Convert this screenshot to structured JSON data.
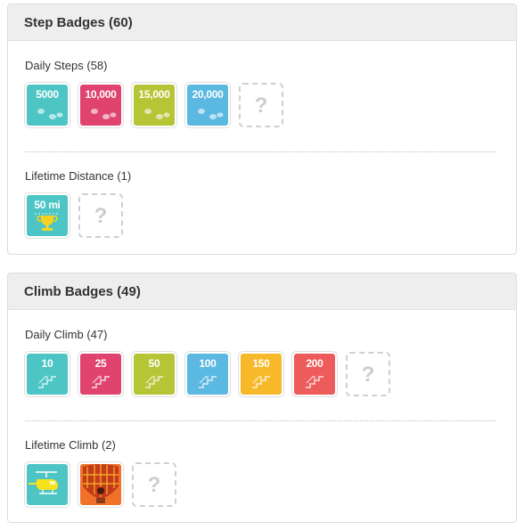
{
  "step_badges": {
    "header": "Step Badges (60)",
    "daily": {
      "title": "Daily Steps (58)",
      "badges": [
        {
          "label": "5000",
          "color": "#4dc5c5",
          "icon": "footprints-icon"
        },
        {
          "label": "10,000",
          "color": "#e0446e",
          "icon": "footprints-icon"
        },
        {
          "label": "15,000",
          "color": "#b5c535",
          "icon": "footprints-icon"
        },
        {
          "label": "20,000",
          "color": "#5bb8e0",
          "icon": "footprints-icon"
        }
      ],
      "locked_label": "?"
    },
    "lifetime": {
      "title": "Lifetime Distance (1)",
      "badges": [
        {
          "label": "50 mi",
          "color": "#4dc5c5",
          "icon": "trophy-icon"
        }
      ],
      "locked_label": "?"
    }
  },
  "climb_badges": {
    "header": "Climb Badges (49)",
    "daily": {
      "title": "Daily Climb (47)",
      "badges": [
        {
          "label": "10",
          "color": "#4dc5c5",
          "icon": "stairs-icon"
        },
        {
          "label": "25",
          "color": "#e0446e",
          "icon": "stairs-icon"
        },
        {
          "label": "50",
          "color": "#b5c535",
          "icon": "stairs-icon"
        },
        {
          "label": "100",
          "color": "#5bb8e0",
          "icon": "stairs-icon"
        },
        {
          "label": "150",
          "color": "#f7b92a",
          "icon": "stairs-icon"
        },
        {
          "label": "200",
          "color": "#ee5b5b",
          "icon": "stairs-icon"
        }
      ],
      "locked_label": "?"
    },
    "lifetime": {
      "title": "Lifetime Climb (2)",
      "badges": [
        {
          "label": "",
          "color": "#4dc5c5",
          "icon": "helicopter-icon"
        },
        {
          "label": "",
          "color": "#f0722a",
          "icon": "hot-air-balloon-icon"
        }
      ],
      "locked_label": "?"
    }
  }
}
